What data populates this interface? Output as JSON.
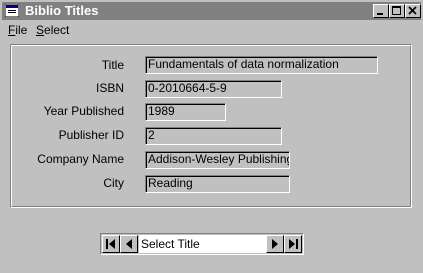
{
  "window": {
    "title": "Biblio Titles"
  },
  "menu": {
    "file": {
      "accel": "F",
      "rest": "ile"
    },
    "select": {
      "accel": "S",
      "rest": "elect"
    }
  },
  "form": {
    "title_label": "Title",
    "title_value": "Fundamentals of data normalization",
    "isbn_label": "ISBN",
    "isbn_value": "0-2010664-5-9",
    "year_label": "Year Published",
    "year_value": "1989",
    "publisher_label": "Publisher ID",
    "publisher_value": "2",
    "company_label": "Company Name",
    "company_value": "Addison-Wesley Publishing",
    "city_label": "City",
    "city_value": "Reading"
  },
  "navigator": {
    "caption": "Select Title"
  },
  "icons": [
    "app-icon",
    "minimize-icon",
    "maximize-icon",
    "close-icon",
    "first-record-icon",
    "previous-record-icon",
    "next-record-icon",
    "last-record-icon"
  ]
}
